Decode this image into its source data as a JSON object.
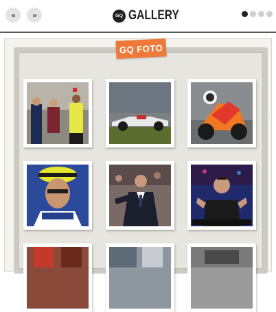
{
  "header": {
    "prev_label": "«",
    "next_label": "»",
    "brand_mark": "GQ",
    "title": "GALLERY",
    "page_dots": [
      {
        "active": true
      },
      {
        "active": false
      },
      {
        "active": false
      },
      {
        "active": false
      }
    ]
  },
  "gallery": {
    "tag_label": "GQ FOTO",
    "thumbnails": [
      {
        "subject": "football players with referee"
      },
      {
        "subject": "racing car on track"
      },
      {
        "subject": "motorcycle racer leaning in turn"
      },
      {
        "subject": "rider in yellow cap"
      },
      {
        "subject": "coach in suit at stadium"
      },
      {
        "subject": "man gesturing on stage"
      },
      {
        "subject": "partially visible photo"
      },
      {
        "subject": "partially visible photo"
      },
      {
        "subject": "partially visible photo"
      }
    ]
  },
  "colors": {
    "accent": "#ee7a3a",
    "header_rule": "#5a5a5a",
    "board": "#e6e5df",
    "frame": "#cdcbc3"
  }
}
